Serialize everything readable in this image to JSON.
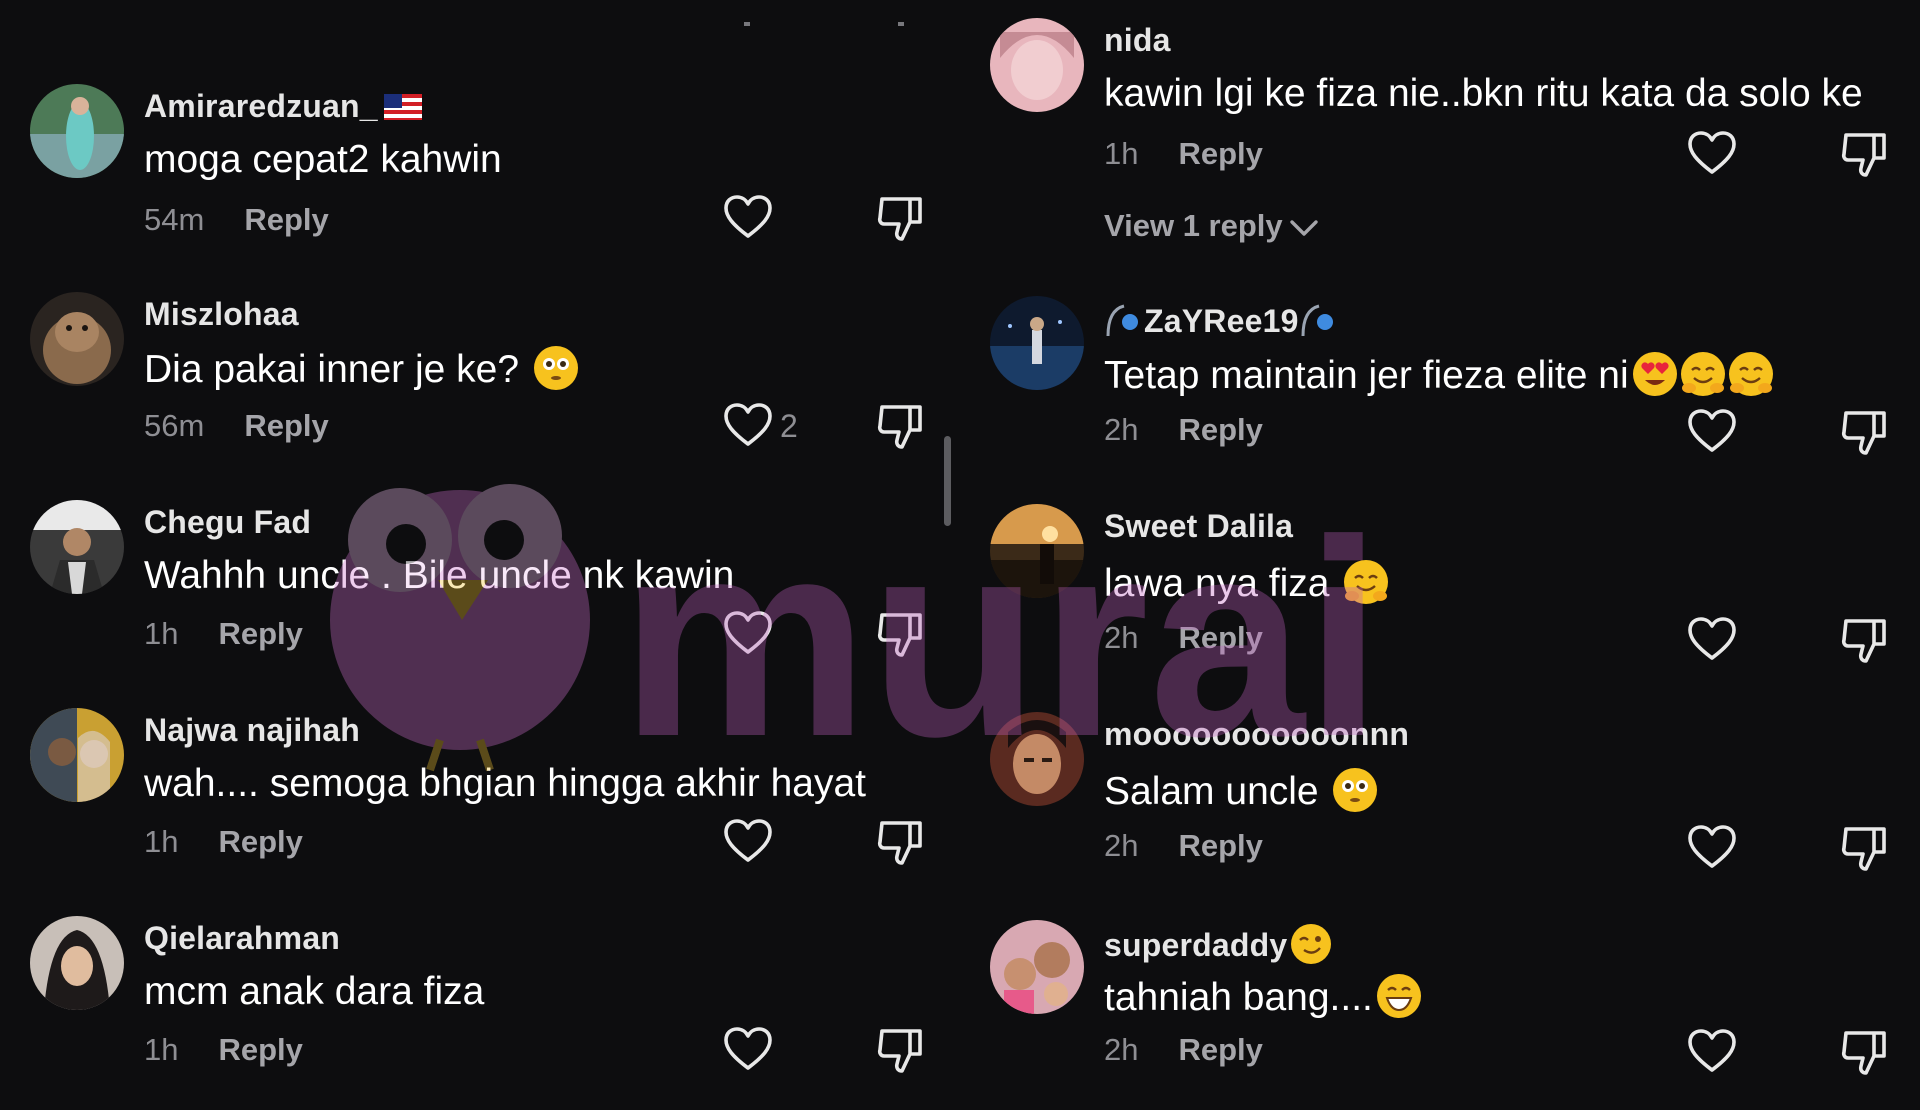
{
  "left": [
    {
      "username": "Amiraredzuan_",
      "text": "moga cepat2 kahwin",
      "time": "54m",
      "reply": "Reply",
      "like_count": ""
    },
    {
      "username": "Miszlohaa",
      "text": "Dia pakai inner je ke?",
      "time": "56m",
      "reply": "Reply",
      "like_count": "2"
    },
    {
      "username": "Chegu Fad",
      "text": "Wahhh uncle . Bile uncle nk kawin",
      "time": "1h",
      "reply": "Reply",
      "like_count": ""
    },
    {
      "username": "Najwa najihah",
      "text": "wah.... semoga bhgian hingga akhir hayat",
      "time": "1h",
      "reply": "Reply",
      "like_count": ""
    },
    {
      "username": "Qielarahman",
      "text": "mcm anak dara fiza",
      "time": "1h",
      "reply": "Reply",
      "like_count": ""
    }
  ],
  "right": [
    {
      "username": "nida",
      "text": "kawin lgi ke fiza nie..bkn ritu kata da solo ke",
      "time": "1h",
      "reply": "Reply",
      "view_replies": "View 1 reply"
    },
    {
      "username": "ZaYRee19",
      "text": "Tetap maintain jer fieza elite ni",
      "time": "2h",
      "reply": "Reply"
    },
    {
      "username": "Sweet Dalila",
      "text": "lawa nya fiza",
      "time": "2h",
      "reply": "Reply"
    },
    {
      "username": "mooooooooooonnn",
      "text": "Salam uncle",
      "time": "2h",
      "reply": "Reply"
    },
    {
      "username": "superdaddy",
      "text": "tahniah bang....",
      "time": "2h",
      "reply": "Reply"
    }
  ],
  "watermark": "murai",
  "icons": {
    "like": "heart-outline-icon",
    "dislike": "thumbs-down-outline-icon",
    "expand": "chevron-down-icon"
  },
  "colors": {
    "background": "#0d0d0f",
    "username": "#e6e6e6",
    "comment": "#ffffff",
    "meta": "#8e8e93",
    "watermark": "#d070d0"
  }
}
